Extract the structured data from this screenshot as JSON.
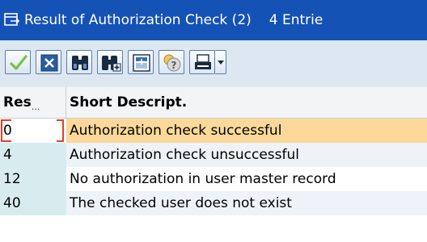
{
  "window": {
    "title": "Result of Authorization Check (2)",
    "entries": "4 Entrie",
    "icon": "popup-window-icon"
  },
  "toolbar": {
    "buttons": [
      {
        "name": "continue-button",
        "icon": "checkmark-icon"
      },
      {
        "name": "cancel-button",
        "icon": "close-x-icon"
      },
      {
        "name": "find-button",
        "icon": "binoculars-icon"
      },
      {
        "name": "find-next-button",
        "icon": "binoculars-plus-icon"
      },
      {
        "name": "select-all-button",
        "icon": "select-all-icon"
      },
      {
        "name": "help-button",
        "icon": "help-icon"
      },
      {
        "name": "print-button",
        "icon": "printer-icon"
      },
      {
        "name": "print-dropdown",
        "icon": "chevron-down-icon"
      }
    ]
  },
  "table": {
    "columns": {
      "result": "Res",
      "result_truncation": "...",
      "description": "Short Descript."
    },
    "rows": [
      {
        "code": "0",
        "description": "Authorization check successful"
      },
      {
        "code": "4",
        "description": "Authorization check unsuccessful"
      },
      {
        "code": "12",
        "description": "No authorization in user master record"
      },
      {
        "code": "40",
        "description": "The checked user does not exist"
      }
    ]
  },
  "colors": {
    "title_bar": "#1552b6",
    "toolbar_bg": "#dde7f2",
    "selected_row": "#fcd99a",
    "key_column": "#d8ecf0",
    "focus_border": "#e0402a"
  }
}
